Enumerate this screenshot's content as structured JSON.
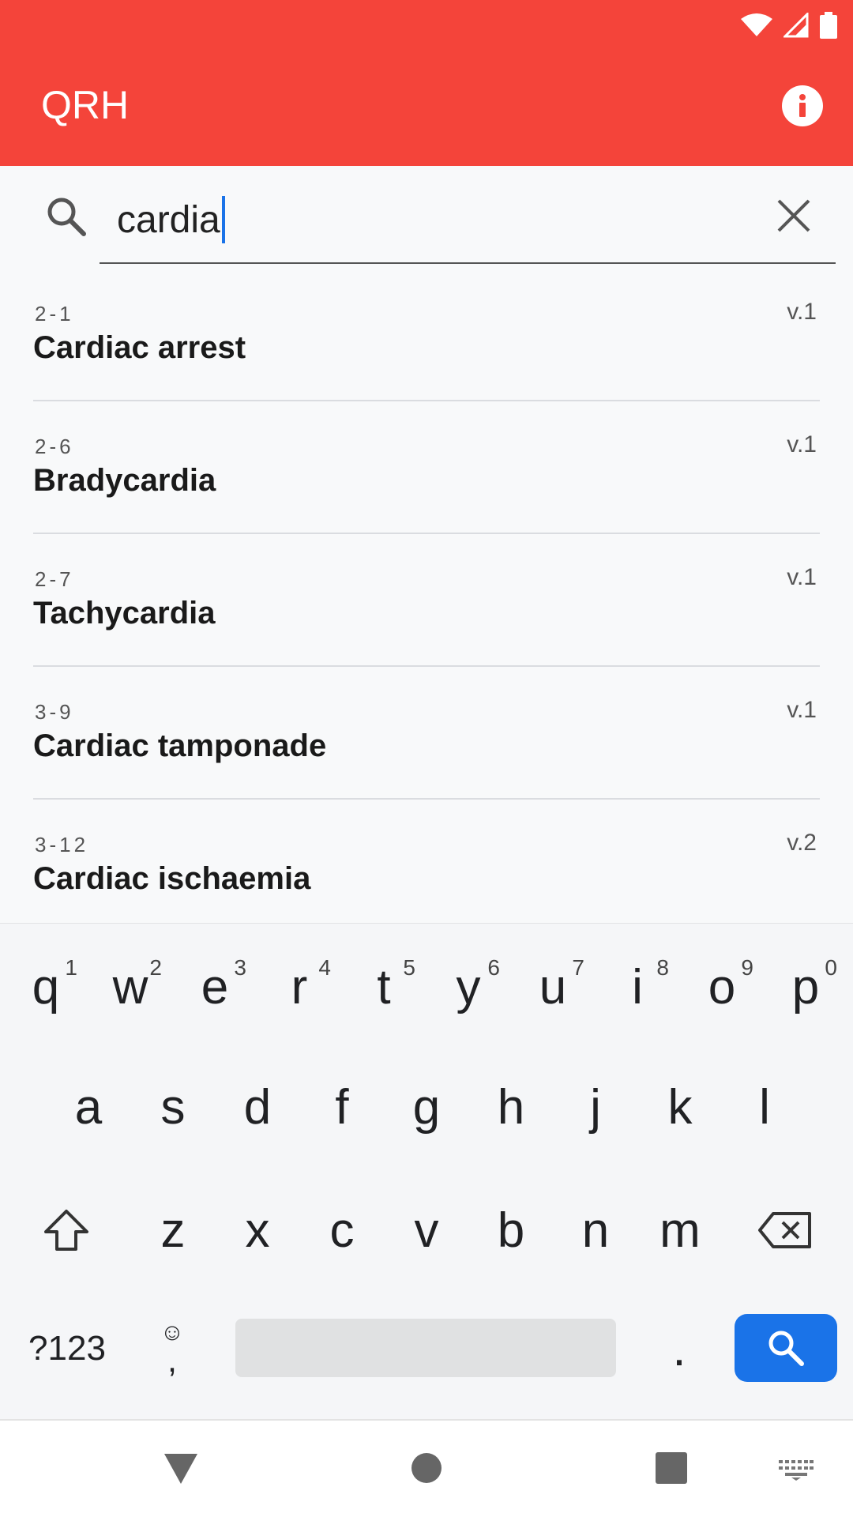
{
  "app": {
    "title": "QRH",
    "brand_color": "#f4443a",
    "accent_color": "#1a73e8"
  },
  "search": {
    "value": "cardia"
  },
  "results": [
    {
      "code": "2-1",
      "title": "Cardiac arrest",
      "version": "v.1"
    },
    {
      "code": "2-6",
      "title": "Bradycardia",
      "version": "v.1"
    },
    {
      "code": "2-7",
      "title": "Tachycardia",
      "version": "v.1"
    },
    {
      "code": "3-9",
      "title": "Cardiac tamponade",
      "version": "v.1"
    },
    {
      "code": "3-12",
      "title": "Cardiac ischaemia",
      "version": "v.2"
    }
  ],
  "keyboard": {
    "row1": [
      {
        "key": "q",
        "hint": "1"
      },
      {
        "key": "w",
        "hint": "2"
      },
      {
        "key": "e",
        "hint": "3"
      },
      {
        "key": "r",
        "hint": "4"
      },
      {
        "key": "t",
        "hint": "5"
      },
      {
        "key": "y",
        "hint": "6"
      },
      {
        "key": "u",
        "hint": "7"
      },
      {
        "key": "i",
        "hint": "8"
      },
      {
        "key": "o",
        "hint": "9"
      },
      {
        "key": "p",
        "hint": "0"
      }
    ],
    "row2": [
      "a",
      "s",
      "d",
      "f",
      "g",
      "h",
      "j",
      "k",
      "l"
    ],
    "row3": [
      "z",
      "x",
      "c",
      "v",
      "b",
      "n",
      "m"
    ],
    "mode_label": "?123",
    "comma_label": ",",
    "emoji_label": "☺",
    "period_label": "."
  },
  "icons": {
    "info": "info-icon",
    "search": "search-icon",
    "clear": "close-icon",
    "shift": "shift-icon",
    "backspace": "backspace-icon",
    "enter": "search-icon",
    "wifi": "wifi-icon",
    "signal": "signal-icon",
    "battery": "battery-icon",
    "nav_back": "back-triangle-icon",
    "nav_home": "home-circle-icon",
    "nav_recent": "recents-square-icon",
    "nav_keyboard": "keyboard-icon"
  }
}
